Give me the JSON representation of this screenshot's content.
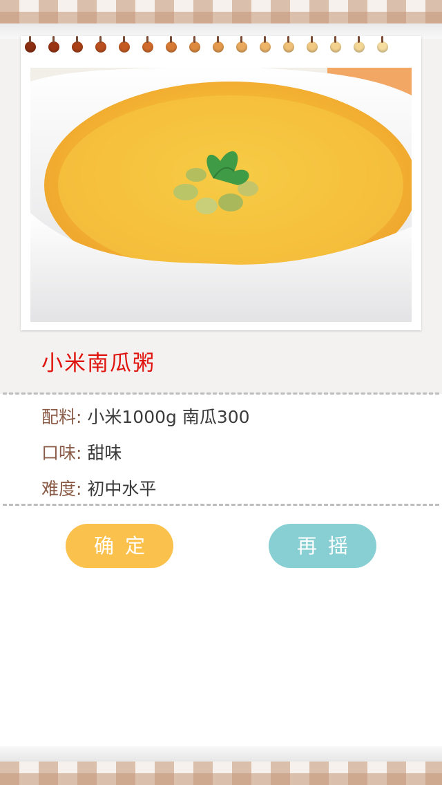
{
  "recipe": {
    "title": "小米南瓜粥",
    "photo_icon": "millet-pumpkin-porridge-photo",
    "ingredients_label": "配料:",
    "ingredients_value": "小米1000g  南瓜300",
    "taste_label": "口味:",
    "taste_value": "甜味",
    "difficulty_label": "难度:",
    "difficulty_value": "初中水平"
  },
  "actions": {
    "confirm_label": "确定",
    "again_label": "再摇"
  },
  "colors": {
    "title": "#e0140e",
    "label": "#8a5b47",
    "confirm_button": "#fbc14d",
    "again_button": "#88cfd3"
  }
}
